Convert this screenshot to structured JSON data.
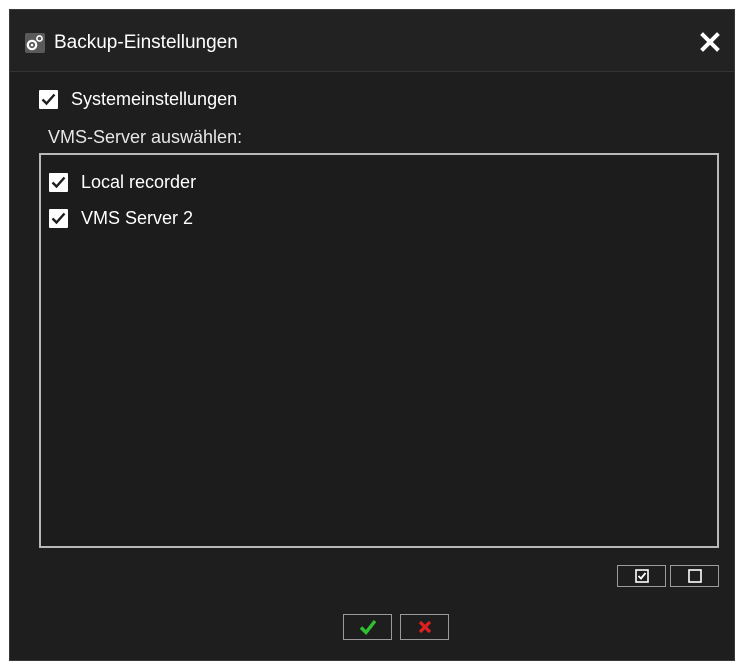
{
  "window": {
    "title": "Backup-Einstellungen",
    "icon": "gears-icon",
    "close_icon": "close-icon"
  },
  "system_settings": {
    "label": "Systemeinstellungen",
    "checked": true
  },
  "server_section": {
    "label": "VMS-Server auswählen:",
    "servers": [
      {
        "label": "Local recorder",
        "checked": true
      },
      {
        "label": "VMS Server 2",
        "checked": true
      }
    ]
  },
  "list_buttons": {
    "select_all_icon": "checked-box-icon",
    "deselect_all_icon": "empty-box-icon"
  },
  "actions": {
    "confirm_icon": "checkmark-icon",
    "confirm_color": "#2fbf2f",
    "cancel_icon": "x-icon",
    "cancel_color": "#e02020"
  },
  "colors": {
    "background": "#1e1e1e",
    "text": "#ffffff",
    "border": "#b8b8b8"
  }
}
